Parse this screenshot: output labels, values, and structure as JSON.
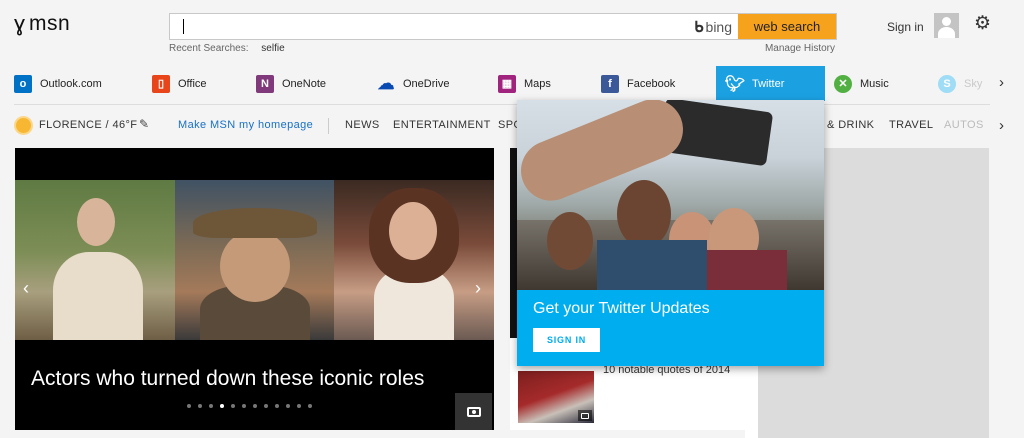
{
  "header": {
    "logo_text": "msn",
    "search": {
      "value": "",
      "placeholder": "",
      "bing_label": "bing",
      "button_label": "web search"
    },
    "recent": {
      "label": "Recent Searches:",
      "value": "selfie"
    },
    "manage_history": "Manage History",
    "sign_in": "Sign in"
  },
  "services": [
    {
      "label": "Outlook.com",
      "icon": "outlook-icon",
      "color": "#0072c6"
    },
    {
      "label": "Office",
      "icon": "office-icon",
      "color": "#e8461a"
    },
    {
      "label": "OneNote",
      "icon": "onenote-icon",
      "color": "#80397b"
    },
    {
      "label": "OneDrive",
      "icon": "onedrive-icon",
      "color": "#094ab2"
    },
    {
      "label": "Maps",
      "icon": "maps-icon",
      "color": "#a0237e"
    },
    {
      "label": "Facebook",
      "icon": "facebook-icon",
      "color": "#3b5998"
    },
    {
      "label": "Twitter",
      "icon": "twitter-icon",
      "color": "#1ba1e2",
      "active": true
    },
    {
      "label": "Music",
      "icon": "xbox-music-icon",
      "color": "#52b043"
    },
    {
      "label": "Sky",
      "icon": "skype-icon",
      "color": "#00aff0"
    }
  ],
  "subnav": {
    "weather": "FLORENCE / 46°F",
    "make_home": "Make MSN my homepage",
    "items": [
      "NEWS",
      "ENTERTAINMENT",
      "SPO",
      "& DRINK",
      "TRAVEL",
      "AUTOS"
    ]
  },
  "hero": {
    "caption": "Actors who turned down these iconic roles",
    "dot_count": 12,
    "active_dot": 3
  },
  "mid_card": {
    "text": "10 notable quotes of 2014"
  },
  "popup": {
    "title": "Get your Twitter Updates",
    "button": "SIGN IN"
  }
}
